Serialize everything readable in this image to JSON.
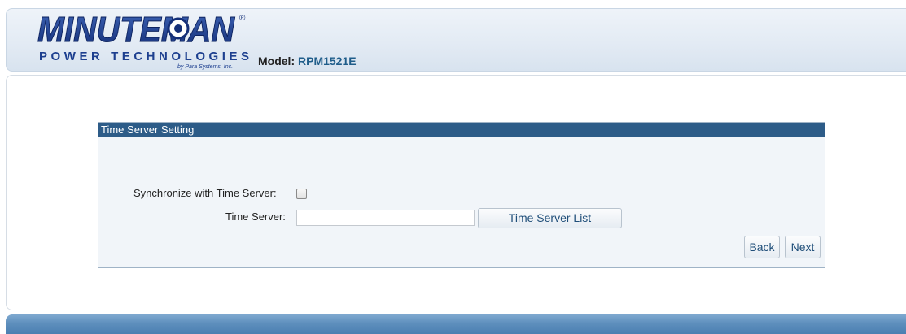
{
  "header": {
    "logo": {
      "brand_top": "MINUTEMAN",
      "registered": "®",
      "brand_bottom": "POWER TECHNOLOGIES",
      "byline": "by Para Systems, Inc."
    },
    "model_label": "Model:",
    "model_value": "RPM1521E"
  },
  "panel": {
    "title": "Time Server Setting",
    "sync_label": "Synchronize with Time Server:",
    "sync_checked": false,
    "server_label": "Time Server:",
    "server_value": "",
    "server_list_button": "Time Server List",
    "back_button": "Back",
    "next_button": "Next"
  },
  "colors": {
    "panel_title_bg": "#2d5c88",
    "model_value": "#1f5d8a",
    "button_text": "#1f4e79",
    "logo_blue": "#1d3f8f",
    "footer_blue": "#5e8fbd"
  }
}
